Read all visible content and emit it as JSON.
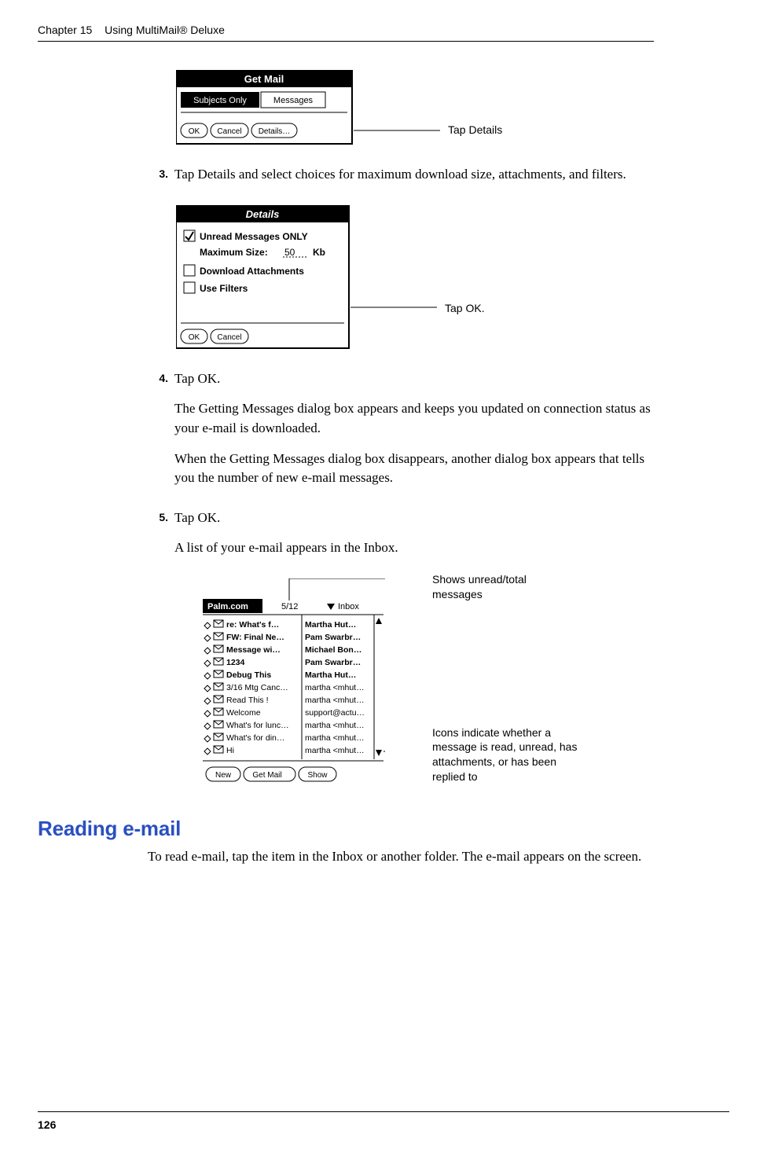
{
  "header": {
    "chapter_label": "Chapter 15",
    "chapter_title": "Using MultiMail® Deluxe"
  },
  "fig1": {
    "title": "Get Mail",
    "tab_left": "Subjects Only",
    "tab_right": "Messages",
    "btn_ok": "OK",
    "btn_cancel": "Cancel",
    "btn_details": "Details…",
    "callout": "Tap Details"
  },
  "step3": {
    "num": "3.",
    "text": "Tap Details and select choices for maximum download size, attachments, and filters."
  },
  "fig2": {
    "title": "Details",
    "row_unread": "Unread Messages ONLY",
    "row_maxsize_a": "Maximum Size:",
    "row_maxsize_b": "50",
    "row_maxsize_c": "Kb",
    "row_dl": "Download Attachments",
    "row_filters": "Use Filters",
    "btn_ok": "OK",
    "btn_cancel": "Cancel",
    "callout": "Tap OK."
  },
  "step4": {
    "num": "4.",
    "line1": "Tap OK.",
    "line2": "The Getting Messages dialog box appears and keeps you updated on connection status as your e-mail is downloaded.",
    "line3": "When the Getting Messages dialog box disappears, another dialog box appears that tells you the number of new e-mail messages."
  },
  "step5": {
    "num": "5.",
    "line1": "Tap OK.",
    "line2": "A list of your e-mail appears in the Inbox."
  },
  "fig3": {
    "callout_top": "Shows unread/total messages",
    "callout_bottom": "Icons indicate whether a message is read, unread, has attachments, or has been replied to",
    "titlebar": "Palm.com",
    "counter": "5/12",
    "folder": "Inbox",
    "rows": [
      {
        "subj": "re: What's f…",
        "from": "Martha Hut…",
        "bold": true
      },
      {
        "subj": "FW: Final Ne…",
        "from": "Pam Swarbr…",
        "bold": true
      },
      {
        "subj": "Message wi…",
        "from": "Michael Bon…",
        "bold": true
      },
      {
        "subj": "1234",
        "from": "Pam Swarbr…",
        "bold": true
      },
      {
        "subj": "Debug This",
        "from": "Martha Hut…",
        "bold": true
      },
      {
        "subj": "3/16 Mtg Canc…",
        "from": "martha <mhut…",
        "bold": false
      },
      {
        "subj": "Read This !",
        "from": "martha <mhut…",
        "bold": false
      },
      {
        "subj": "Welcome",
        "from": "support@actu…",
        "bold": false
      },
      {
        "subj": "What's for lunc…",
        "from": "martha <mhut…",
        "bold": false
      },
      {
        "subj": "What's for din…",
        "from": "martha <mhut…",
        "bold": false
      },
      {
        "subj": "Hi",
        "from": "martha <mhut…",
        "bold": false
      }
    ],
    "btn_new": "New",
    "btn_get": "Get Mail",
    "btn_show": "Show"
  },
  "section": {
    "heading": "Reading e-mail",
    "body": "To read e-mail, tap the item in the Inbox or another folder. The e-mail appears on the screen."
  },
  "footer": {
    "page": "126"
  }
}
